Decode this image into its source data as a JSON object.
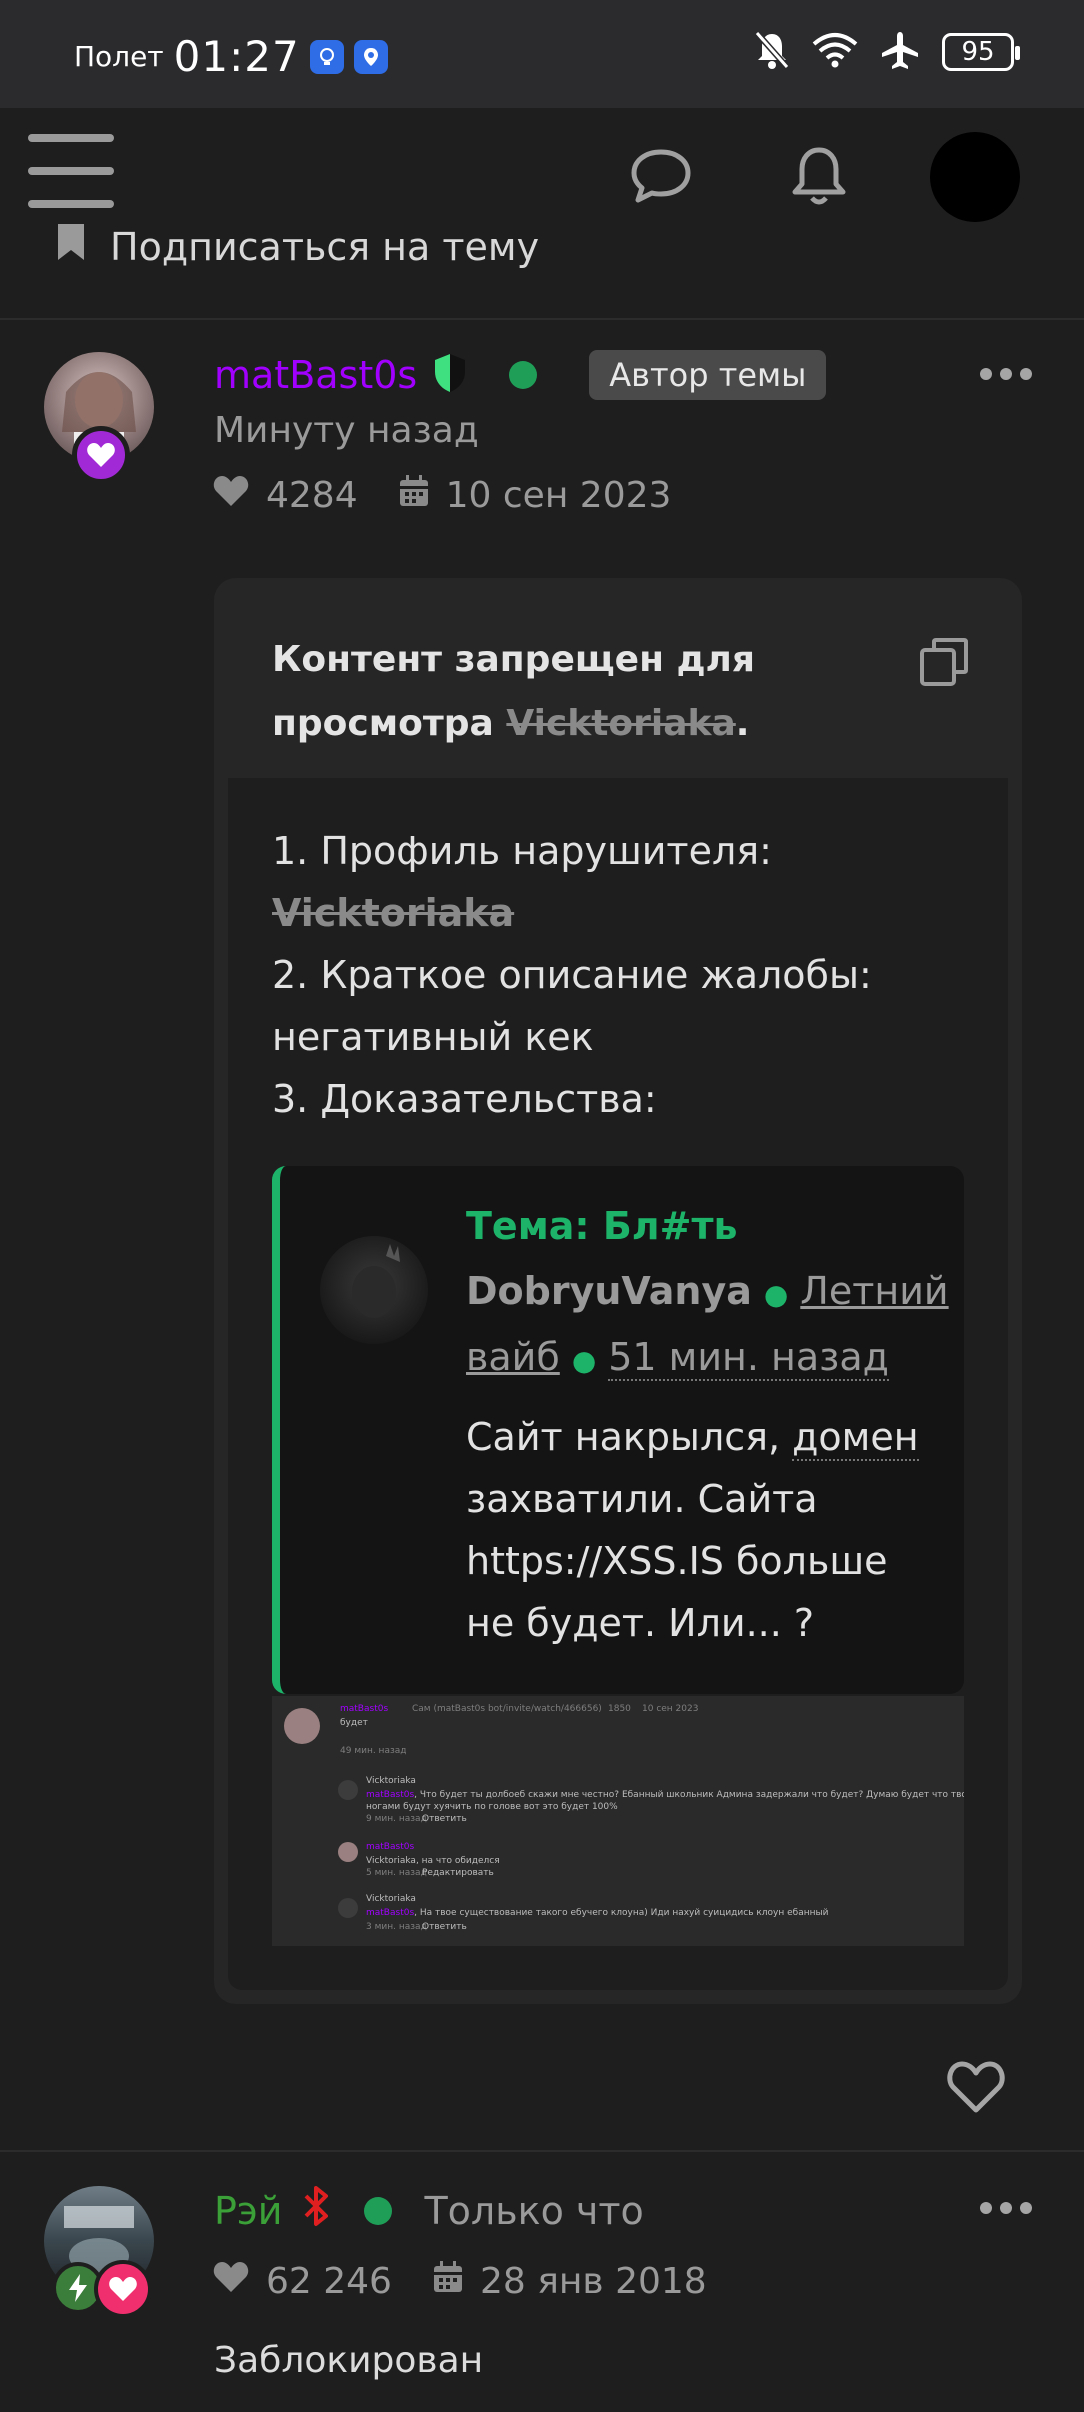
{
  "status_bar": {
    "carrier": "Полет",
    "time": "01:27",
    "battery": "95"
  },
  "subscribe": {
    "label": "Подписаться на тему"
  },
  "post": {
    "author": "matBast0s",
    "author_tag": "Автор темы",
    "time": "Минуту назад",
    "likes": "4284",
    "date": "10 сен 2023",
    "card_title_prefix": "Контент запрещен для просмотра",
    "card_title_user": "Vicktoriaka",
    "card_title_suffix": ".",
    "list": {
      "item1": "1. Профиль нарушителя:",
      "item1_user": "Vicktoriaka",
      "item2": "2. Краткое описание жалобы:",
      "item2_text": "негативный кек",
      "item3": "3. Доказательства:"
    },
    "quote": {
      "topic": "Тема: Бл#ть",
      "user": "DobryuVanya",
      "section_a": "Летний",
      "section_b": "вайб",
      "time": "51 мин. назад",
      "text_a": "Сайт накрылся,",
      "text_b": "домен",
      "text_c": "захватили. Сайта https://XSS.IS больше не будет. Или... ?"
    },
    "screenshot": {
      "r1_user": "matBast0s",
      "r1_link": "Сам (matBast0s bot/invite/watch/466656)",
      "r1_likes": "1850",
      "r1_date": "10 сен 2023",
      "r1_text": "будет",
      "r1_time": "49 мин. назад",
      "r2_user": "Vicktoriaka",
      "r2_mention": "matBast0s",
      "r2_text_a": ", Что будет ты долбоеб скажи мне честно? Ебанный школьник Админа задержали что будет? Думаю будет что твою мать",
      "r2_text_b": "ногами будут хуячить по голове вот это будет 100%",
      "r2_time": "9 мин. назад",
      "r2_reply": "Ответить",
      "r3_user": "matBast0s",
      "r3_text": "Vicktoriaka, на что обиделся",
      "r3_time": "5 мин. назад",
      "r3_edit": "Редактировать",
      "r4_user": "Vicktoriaka",
      "r4_mention": "matBast0s",
      "r4_text": ", На твое существование такого ебучего клоуна) Иди нахуй суицидись клоун ебанный",
      "r4_time": "3 мин. назад",
      "r4_reply": "Ответить"
    }
  },
  "post2": {
    "author": "Рэй",
    "time": "Только что",
    "likes": "62 246",
    "date": "28 янв 2018",
    "status": "Заблокирован"
  },
  "colors": {
    "accent_green": "#1db46a",
    "author_purple": "#a100ff",
    "author2_green": "#3aa037",
    "background": "#1e1e1e"
  },
  "icons": [
    "wifi-icon",
    "airplane-icon",
    "bell-off-icon",
    "chat-bubble-icon",
    "bell-icon",
    "bookmark-icon",
    "heart-icon",
    "calendar-icon",
    "copy-icon"
  ]
}
